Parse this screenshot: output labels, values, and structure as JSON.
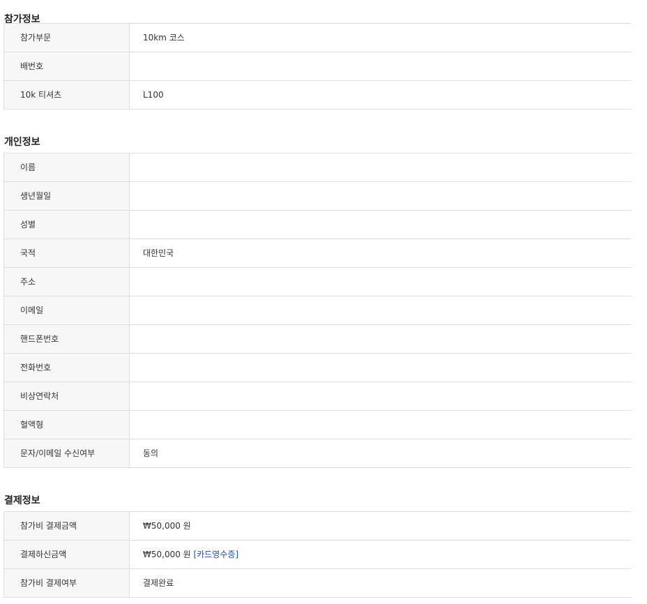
{
  "sections": [
    {
      "title": "참가정보",
      "rows": [
        {
          "label": "참가부문",
          "value": "10km 코스"
        },
        {
          "label": "배번호",
          "value": ""
        },
        {
          "label": "10k 티셔츠",
          "value": "L100"
        }
      ]
    },
    {
      "title": "개인정보",
      "rows": [
        {
          "label": "이름",
          "value": ""
        },
        {
          "label": "생년월일",
          "value": ""
        },
        {
          "label": "성별",
          "value": ""
        },
        {
          "label": "국적",
          "value": "대한민국"
        },
        {
          "label": "주소",
          "value": ""
        },
        {
          "label": "이메일",
          "value": ""
        },
        {
          "label": "핸드폰번호",
          "value": ""
        },
        {
          "label": "전화번호",
          "value": ""
        },
        {
          "label": "비상연락처",
          "value": ""
        },
        {
          "label": "혈액형",
          "value": ""
        },
        {
          "label": "문자/이메일 수신여부",
          "value": "동의"
        }
      ]
    },
    {
      "title": "결제정보",
      "rows": [
        {
          "label": "참가비 결제금액",
          "value": "₩50,000 원"
        },
        {
          "label": "결제하신금액",
          "value": "₩50,000 원",
          "link": "[카드영수증]"
        },
        {
          "label": "참가비 결제여부",
          "value": "결제완료"
        }
      ]
    }
  ],
  "colors": {
    "border": "#dddddd",
    "label_bg": "#f7f7f7",
    "link": "#1a4f9c"
  }
}
